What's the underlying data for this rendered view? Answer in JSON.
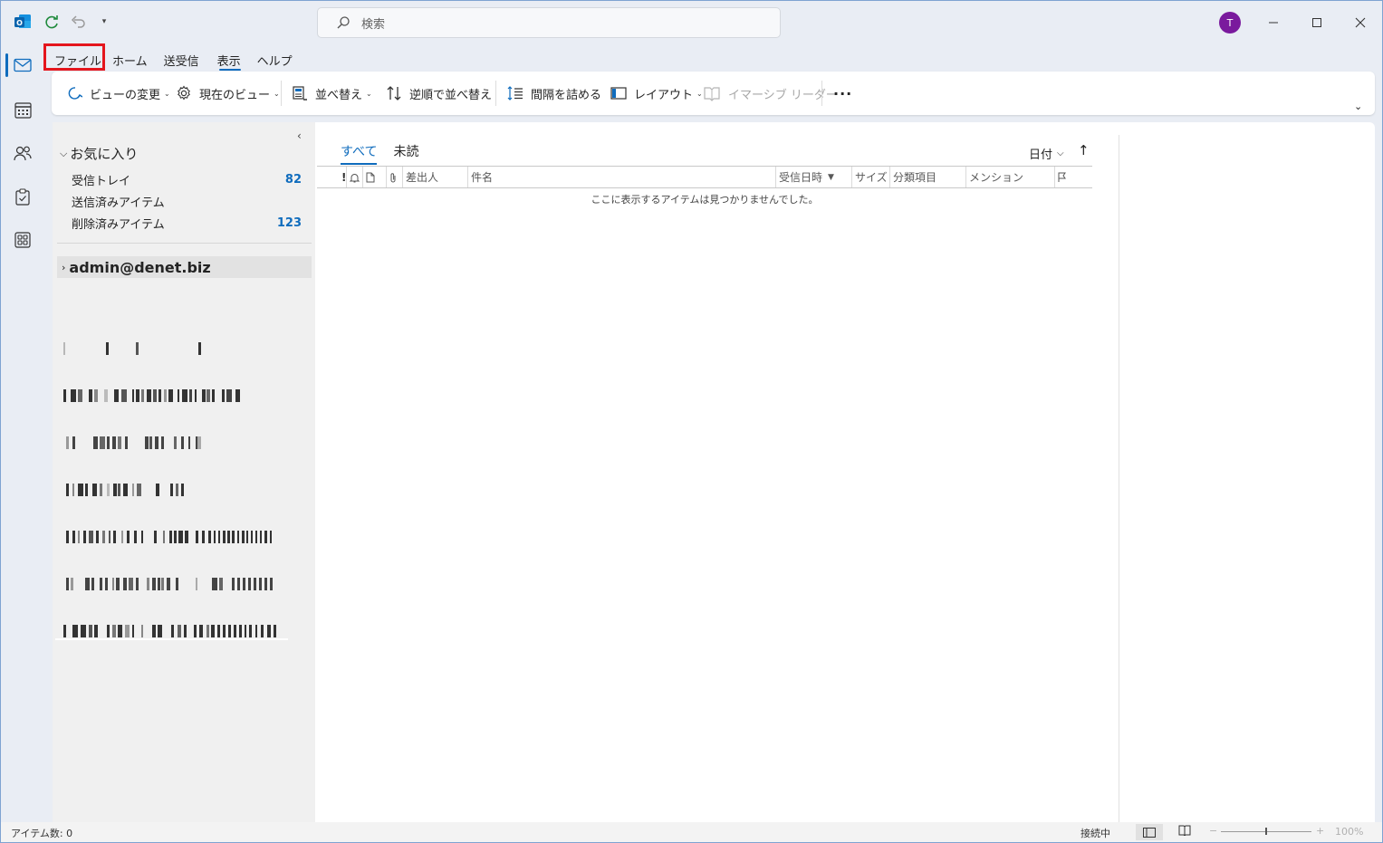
{
  "window": {
    "search_placeholder": "検索",
    "avatar_initial": "T",
    "accent_color": "#0f6cbd"
  },
  "menu_tabs": [
    {
      "label": "ファイル"
    },
    {
      "label": "ホーム"
    },
    {
      "label": "送受信"
    },
    {
      "label": "表示"
    },
    {
      "label": "ヘルプ"
    }
  ],
  "ribbon": {
    "change_view": "ビューの変更",
    "current_view": "現在のビュー",
    "sort": "並べ替え",
    "reverse_sort": "逆順で並べ替え",
    "condense": "間隔を詰める",
    "layout": "レイアウト",
    "immersive_reader": "イマーシブ リーダー",
    "more": "···"
  },
  "folder_pane": {
    "favorites": "お気に入り",
    "folders": [
      {
        "name": "受信トレイ",
        "count": "82"
      },
      {
        "name": "送信済みアイテム",
        "count": ""
      },
      {
        "name": "削除済みアイテム",
        "count": "123"
      }
    ],
    "account": "admin@denet.biz"
  },
  "message_list": {
    "tabs": [
      {
        "label": "すべて"
      },
      {
        "label": "未読"
      }
    ],
    "sort_by": "日付",
    "sort_direction": "↑",
    "columns": {
      "importance": "!",
      "sender": "差出人",
      "subject": "件名",
      "received": "受信日時",
      "size": "サイズ",
      "category": "分類項目",
      "mention": "メンション"
    },
    "empty_message": "ここに表示するアイテムは見つかりませんでした。"
  },
  "status_bar": {
    "item_count": "アイテム数: 0",
    "connection": "接続中",
    "zoom": "100%"
  }
}
